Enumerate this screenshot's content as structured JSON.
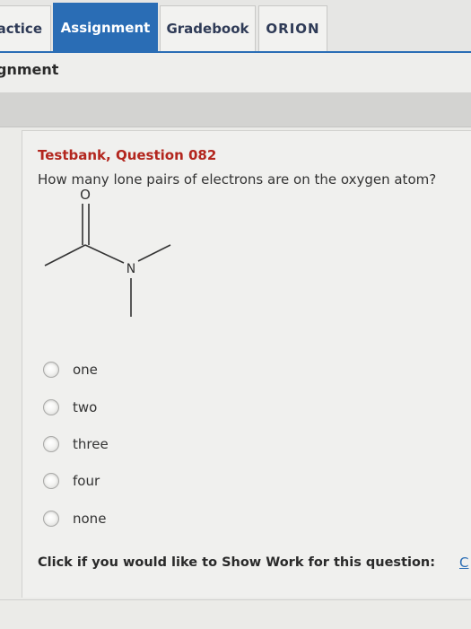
{
  "tabs": {
    "practice": "actice",
    "assignment": "Assignment",
    "gradebook": "Gradebook",
    "orion": "ORION"
  },
  "header": {
    "heading": "gnment"
  },
  "question": {
    "title": "Testbank, Question 082",
    "text": "How many lone pairs of electrons are on the oxygen atom?",
    "atoms": {
      "oxygen": "O",
      "nitrogen": "N"
    }
  },
  "options": [
    {
      "label": "one"
    },
    {
      "label": "two"
    },
    {
      "label": "three"
    },
    {
      "label": "four"
    },
    {
      "label": "none"
    }
  ],
  "show_work": {
    "prompt": "Click if you would like to Show Work for this question:",
    "link": "C"
  }
}
